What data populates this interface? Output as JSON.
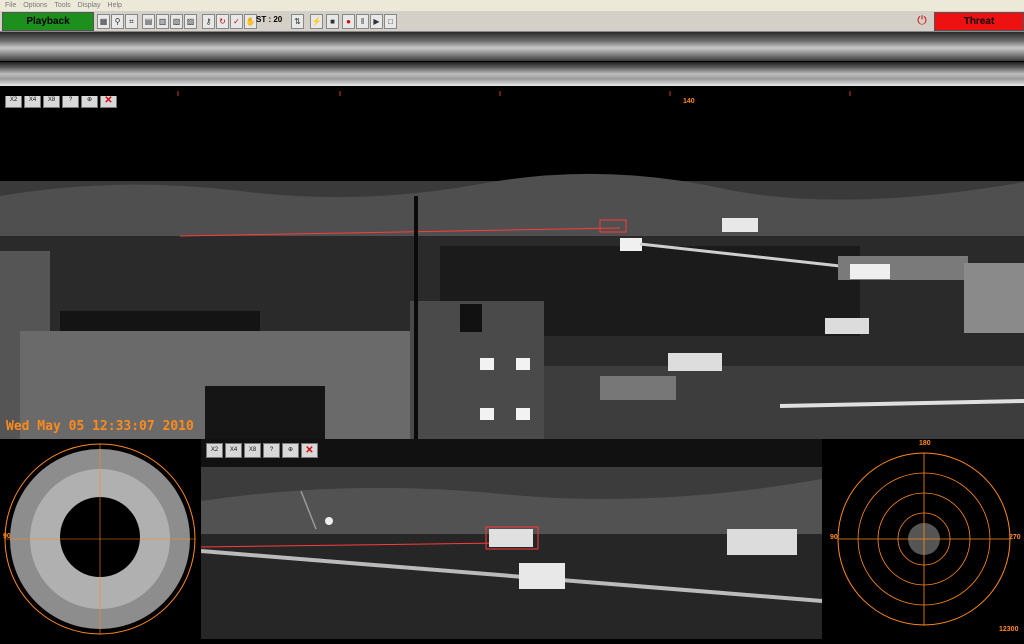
{
  "menu": [
    "File",
    "Options",
    "Tools",
    "Display",
    "Help"
  ],
  "toolbar": {
    "playback_label": "Playback",
    "status_label": "ST : 20",
    "threat_label": "Threat",
    "colors": {
      "playback": "#1c8f1c",
      "threat": "#e11111"
    }
  },
  "main_view": {
    "zoom_buttons": [
      "X2",
      "X4",
      "X8",
      "?"
    ],
    "bearing_label": "140",
    "timestamp": "Wed May 05 12:33:07 2010"
  },
  "sub_view": {
    "zoom_buttons": [
      "X2",
      "X4",
      "X8",
      "?"
    ]
  },
  "polar_view": {
    "angle_label": "90"
  },
  "radar": {
    "top_label": "180",
    "left_label": "90",
    "right_label": "270",
    "bottom_right_label": "12300",
    "accent": "#ff8a1c"
  }
}
